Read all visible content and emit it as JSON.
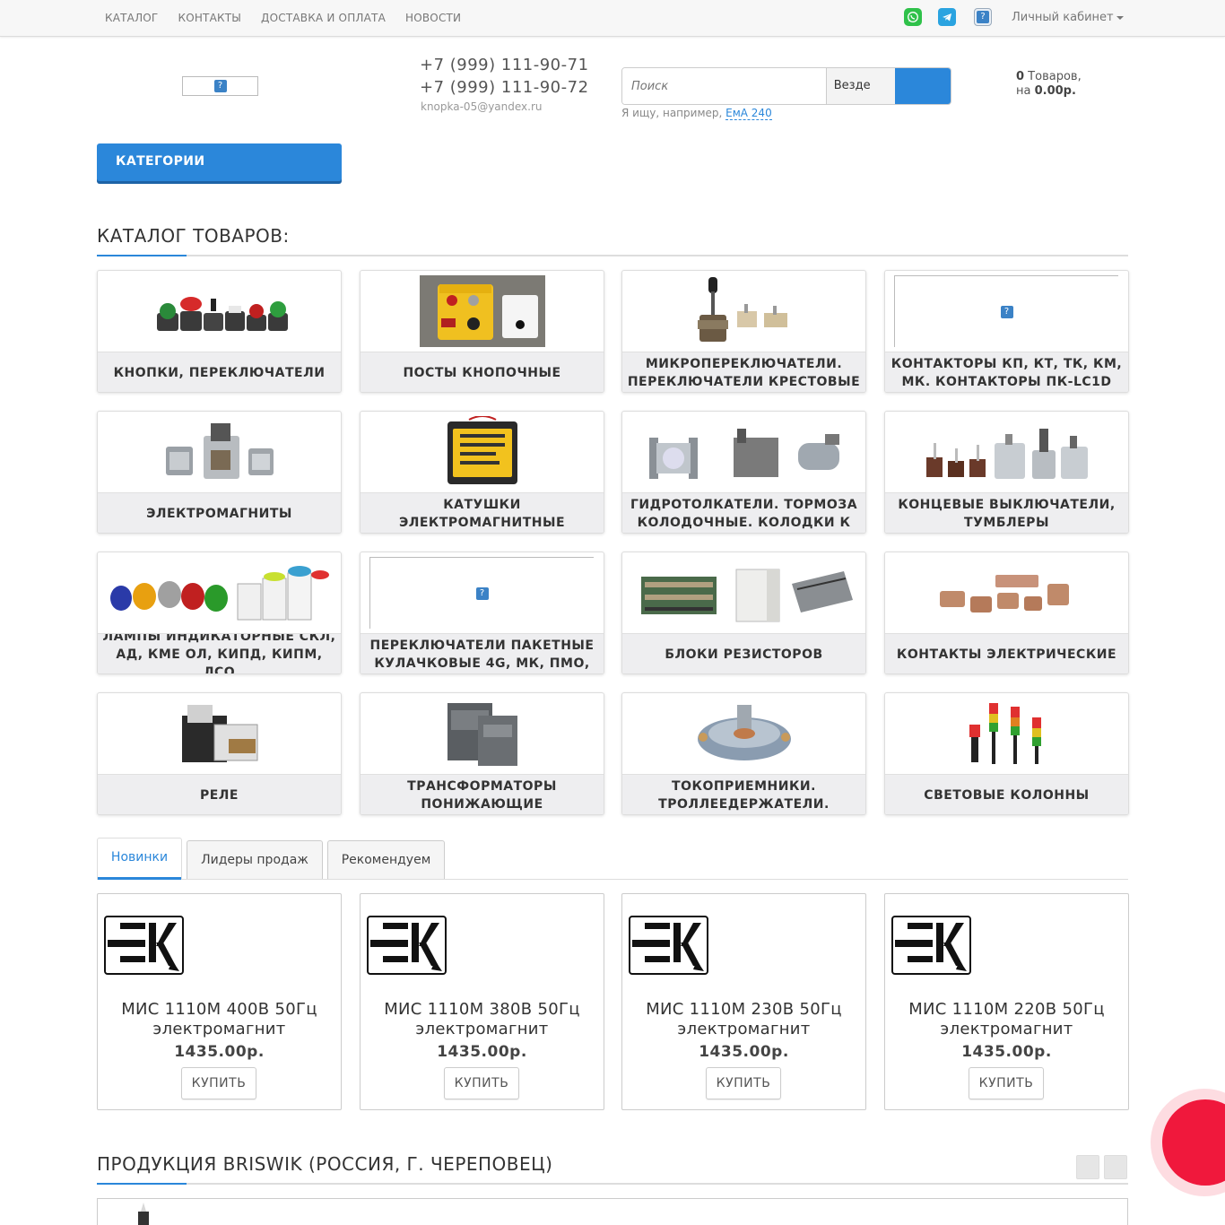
{
  "topnav": {
    "items": [
      "КАТАЛОГ",
      "КОНТАКТЫ",
      "ДОСТАВКА И ОПЛАТА",
      "НОВОСТИ"
    ],
    "cabinet_label": "Личный кабинет"
  },
  "header": {
    "phone1": "+7 (999) 111-90-71",
    "phone2": "+7 (999) 111-90-72",
    "email": "knopka-05@yandex.ru"
  },
  "search": {
    "placeholder": "Поиск",
    "scope": "Везде",
    "hint_prefix": "Я ищу, например,",
    "hint_example": "ЕмА 240"
  },
  "cart": {
    "count": "0",
    "count_suffix": " Товаров,",
    "sum_prefix": "на ",
    "sum": "0.00р."
  },
  "categories_button": "КАТЕГОРИИ",
  "catalog": {
    "title": "КАТАЛОГ ТОВАРОВ:",
    "items": [
      {
        "name": "Кнопки, переключатели",
        "icon": "buttons-image"
      },
      {
        "name": "Посты кнопочные",
        "icon": "control-station-image"
      },
      {
        "name": "Микропереключатели. Переключатели крестовые",
        "icon": "microswitch-image"
      },
      {
        "name": "Контакторы КП, КТ, ТК, КМ, МК. Контакторы ПК-LC1D",
        "icon": "broken-image"
      },
      {
        "name": "Электромагниты",
        "icon": "electromagnet-image"
      },
      {
        "name": "Катушки электромагнитные",
        "icon": "coil-image"
      },
      {
        "name": "Гидротолкатели. Тормоза колодочные. Колодки к",
        "icon": "brake-image"
      },
      {
        "name": "Концевые выключатели, тумблеры",
        "icon": "limit-switch-image"
      },
      {
        "name": "Лампы индикаторные СКЛ, АД, КМЕ ОЛ, КИПД, КИПМ, ЛСО",
        "icon": "indicator-lamp-image"
      },
      {
        "name": "Переключатели пакетные кулачковые 4G, МК, ПМО,",
        "icon": "broken-image"
      },
      {
        "name": "Блоки резисторов",
        "icon": "resistor-block-image"
      },
      {
        "name": "Контакты электрические",
        "icon": "contacts-image"
      },
      {
        "name": "Реле",
        "icon": "relay-image"
      },
      {
        "name": "Трансформаторы понижающие",
        "icon": "transformer-image"
      },
      {
        "name": "Токоприемники. Троллеедержатели.",
        "icon": "current-collector-image"
      },
      {
        "name": "Световые колонны",
        "icon": "signal-tower-image"
      }
    ]
  },
  "tabs": [
    "Новинки",
    "Лидеры продаж",
    "Рекомендуем"
  ],
  "products": [
    {
      "name": "МИС 1110М 400В 50Гц электромагнит",
      "price": "1435.00р.",
      "buy": "КУПИТЬ"
    },
    {
      "name": "МИС 1110М 380В 50Гц электромагнит",
      "price": "1435.00р.",
      "buy": "КУПИТЬ"
    },
    {
      "name": "МИС 1110М 230В 50Гц электромагнит",
      "price": "1435.00р.",
      "buy": "КУПИТЬ"
    },
    {
      "name": "МИС 1110М 220В 50Гц электромагнит",
      "price": "1435.00р.",
      "buy": "КУПИТЬ"
    }
  ],
  "briswik": {
    "title": "ПРОДУКЦИЯ BRISWIK (РОССИЯ, Г. ЧЕРЕПОВЕЦ)"
  },
  "colors": {
    "accent": "#2b87da",
    "callback": "#f0183c",
    "whatsapp": "#2fc14a",
    "telegram": "#2aa3e0"
  }
}
